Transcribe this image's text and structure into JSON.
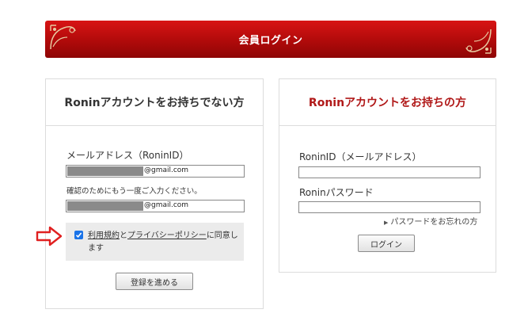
{
  "banner": {
    "title": "会員ログイン"
  },
  "new_member": {
    "heading": "Roninアカウントをお持ちでない方",
    "email_label": "メールアドレス（RoninID）",
    "email_value_suffix": "@gmail.com",
    "confirm_text": "確認のためにもう一度ご入力ください。",
    "confirm_value_suffix": "@gmail.com",
    "agree": {
      "checked": true,
      "terms_link": "利用規約",
      "and": "と",
      "privacy_link": "プライバシーポリシー",
      "tail": "に同意します"
    },
    "register_button": "登録を進める"
  },
  "member": {
    "heading": "Roninアカウントをお持ちの方",
    "id_label": "RoninID（メールアドレス）",
    "password_label": "Roninパスワード",
    "forgot_link": "パスワードをお忘れの方",
    "login_button": "ログイン"
  },
  "colors": {
    "brand_red": "#b01818",
    "banner_red": "#c80f0f",
    "arrow_red": "#e02020",
    "checkbox_blue": "#1a73e8"
  },
  "icons": {
    "ornament": "flourish-icon",
    "arrow": "pointer-arrow-icon",
    "forgot": "triangle-right-icon"
  }
}
